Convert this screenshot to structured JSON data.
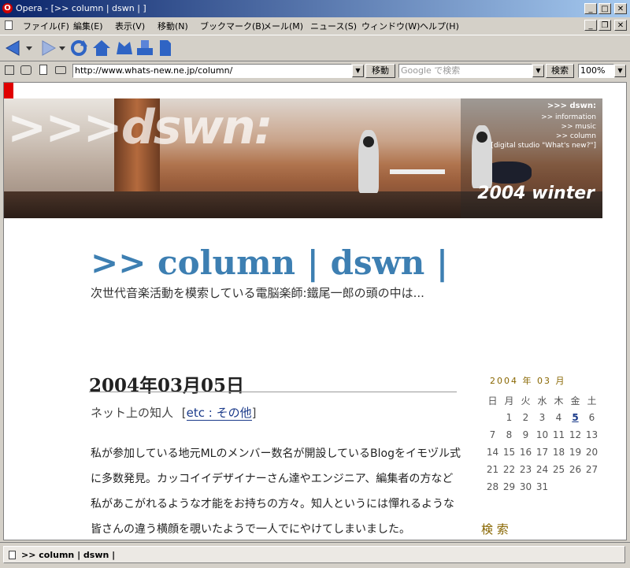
{
  "window": {
    "title": "Opera - [>> column | dswn | ]",
    "minimize": "_",
    "maximize": "□",
    "close": "✕",
    "restore": "❐"
  },
  "menubar": [
    "ファイル(F)",
    "編集(E)",
    "表示(V)",
    "移動(N)",
    "ブックマーク(B)",
    "メール(M)",
    "ニュース(S)",
    "ウィンドウ(W)",
    "ヘルプ(H)"
  ],
  "address": {
    "url": "http://www.whats-new.ne.jp/column/",
    "go_label": "移動",
    "search_placeholder": "Google で検索",
    "search_button": "検索",
    "zoom": "100%"
  },
  "banner": {
    "logo": ">>>dswn:",
    "nav": [
      ">>> dswn:",
      ">> information",
      ">> music",
      ">> column",
      "[digital studio \"What's new?\"]"
    ],
    "season": "2004 winter"
  },
  "page": {
    "site_title": ">> column | dswn |",
    "site_desc": "次世代音楽活動を模索している電脳楽師:鐵尾一郎の頭の中は...",
    "date": "2004年03月05日",
    "post_title": "ネット上の知人",
    "post_category": "etc : その他",
    "post_body": "私が参加している地元MLのメンバー数名が開設しているBlogをイモヅル式に多数発見。カッコイイデザイナーさん達やエンジニア、編集者の方など私があこがれるような才能をお持ちの方々。知人というには憚れるような皆さんの違う横顔を覗いたようで一人でにやけてしまいました。"
  },
  "calendar": {
    "title": "2004 年 03 月",
    "weekdays": [
      "日",
      "月",
      "火",
      "水",
      "木",
      "金",
      "土"
    ],
    "weeks": [
      [
        "",
        "1",
        "2",
        "3",
        "4",
        "5",
        "6"
      ],
      [
        "7",
        "8",
        "9",
        "10",
        "11",
        "12",
        "13"
      ],
      [
        "14",
        "15",
        "16",
        "17",
        "18",
        "19",
        "20"
      ],
      [
        "21",
        "22",
        "23",
        "24",
        "25",
        "26",
        "27"
      ],
      [
        "28",
        "29",
        "30",
        "31",
        "",
        "",
        ""
      ]
    ],
    "linked_day": "5"
  },
  "sidebar": {
    "search_label": "検 索"
  },
  "statusbar": {
    "tab_title": ">> column | dswn |"
  }
}
